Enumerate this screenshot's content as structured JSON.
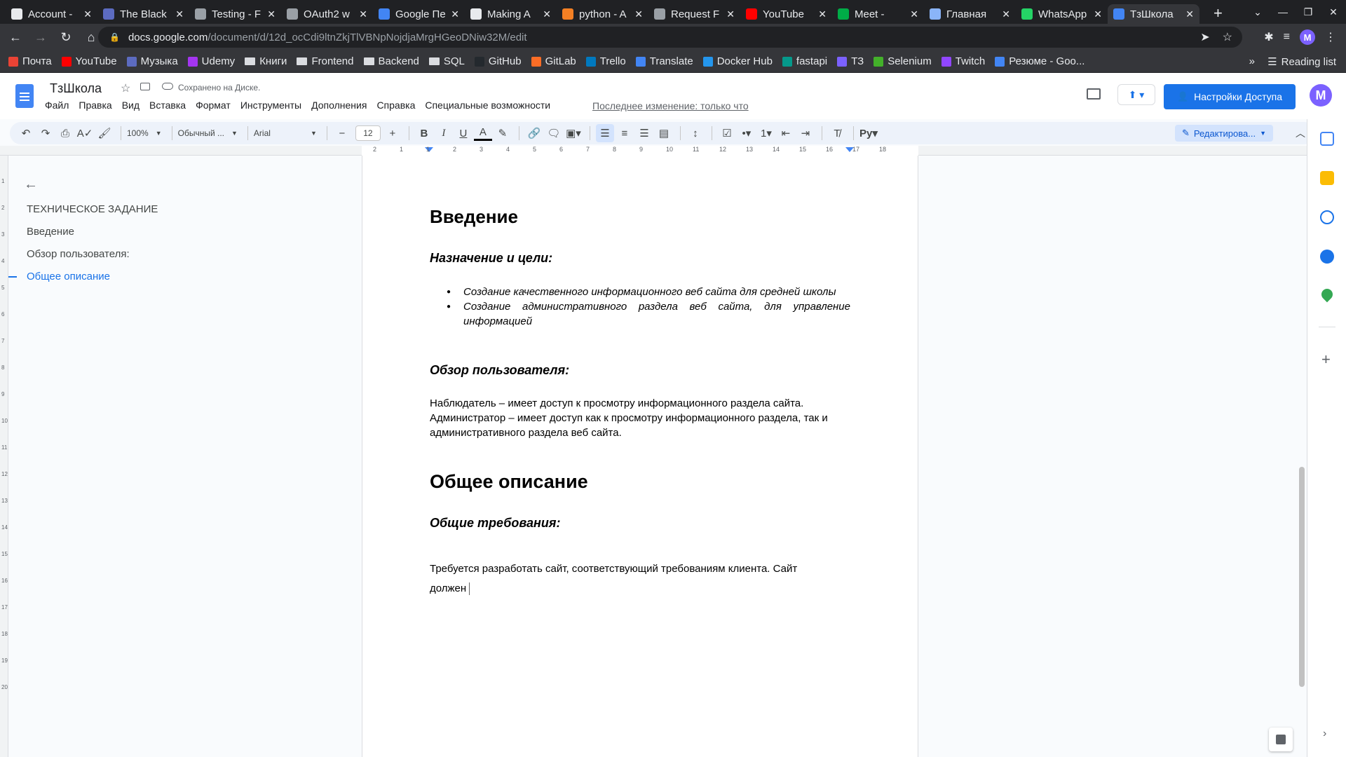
{
  "browser": {
    "tabs": [
      {
        "title": "Account -",
        "color": "#e8eaed"
      },
      {
        "title": "The Black",
        "color": "#5c6bc0"
      },
      {
        "title": "Testing - F",
        "color": "#9aa0a6"
      },
      {
        "title": "OAuth2 w",
        "color": "#9aa0a6"
      },
      {
        "title": "Google Пе",
        "color": "#4285f4"
      },
      {
        "title": "Making A",
        "color": "#e8eaed"
      },
      {
        "title": "python - A",
        "color": "#f48024"
      },
      {
        "title": "Request F",
        "color": "#9aa0a6"
      },
      {
        "title": "YouTube",
        "color": "#ff0000"
      },
      {
        "title": "Meet -",
        "color": "#00ac47"
      },
      {
        "title": "Главная",
        "color": "#8ab4f8"
      },
      {
        "title": "WhatsApp",
        "color": "#25d366"
      },
      {
        "title": "ТзШкола",
        "color": "#4285f4",
        "active": true
      }
    ],
    "url_host": "docs.google.com",
    "url_path": "/document/d/12d_ocCdi9ltnZkjTlVBNpNojdjaMrgHGeoDNiw32M/edit",
    "profile_letter": "M",
    "bookmarks": [
      {
        "label": "Почта",
        "type": "icon",
        "color": "#ea4335"
      },
      {
        "label": "YouTube",
        "type": "icon",
        "color": "#ff0000"
      },
      {
        "label": "Музыка",
        "type": "icon",
        "color": "#5c6bc0"
      },
      {
        "label": "Udemy",
        "type": "icon",
        "color": "#a435f0"
      },
      {
        "label": "Книги",
        "type": "folder"
      },
      {
        "label": "Frontend",
        "type": "folder"
      },
      {
        "label": "Backend",
        "type": "folder"
      },
      {
        "label": "SQL",
        "type": "folder"
      },
      {
        "label": "GitHub",
        "type": "icon",
        "color": "#24292e"
      },
      {
        "label": "GitLab",
        "type": "icon",
        "color": "#fc6d26"
      },
      {
        "label": "Trello",
        "type": "icon",
        "color": "#0079bf"
      },
      {
        "label": "Translate",
        "type": "icon",
        "color": "#4285f4"
      },
      {
        "label": "Docker Hub",
        "type": "icon",
        "color": "#2496ed"
      },
      {
        "label": "fastapi",
        "type": "icon",
        "color": "#05998b"
      },
      {
        "label": "ТЗ",
        "type": "icon",
        "color": "#7b61ff"
      },
      {
        "label": "Selenium",
        "type": "icon",
        "color": "#43b02a"
      },
      {
        "label": "Twitch",
        "type": "icon",
        "color": "#9146ff"
      },
      {
        "label": "Резюме - Goo...",
        "type": "icon",
        "color": "#4285f4"
      }
    ],
    "bookmarks_more": "»",
    "reading_list": "Reading list"
  },
  "docs": {
    "title": "ТзШкола",
    "saved_status": "Сохранено на Диске.",
    "menu": [
      "Файл",
      "Правка",
      "Вид",
      "Вставка",
      "Формат",
      "Инструменты",
      "Дополнения",
      "Справка",
      "Специальные возможности"
    ],
    "last_edit": "Последнее изменение: только что",
    "share_label": "Настройки Доступа",
    "avatar_letter": "M",
    "toolbar": {
      "zoom": "100%",
      "style": "Обычный ...",
      "font": "Arial",
      "font_size": "12",
      "edit_mode": "Редактирова..."
    },
    "ruler_numbers": [
      "2",
      "1",
      "1",
      "2",
      "3",
      "4",
      "5",
      "6",
      "7",
      "8",
      "9",
      "10",
      "11",
      "12",
      "13",
      "14",
      "15",
      "16",
      "17",
      "18"
    ],
    "vruler_numbers": [
      "1",
      "2",
      "3",
      "4",
      "5",
      "6",
      "7",
      "8",
      "9",
      "10",
      "11",
      "12",
      "13",
      "14",
      "15",
      "16",
      "17",
      "18",
      "19",
      "20"
    ]
  },
  "outline": {
    "items": [
      {
        "label": "ТЕХНИЧЕСКОЕ ЗАДАНИЕ",
        "active": false
      },
      {
        "label": "Введение",
        "active": false
      },
      {
        "label": "Обзор пользователя:",
        "active": false
      },
      {
        "label": "Общее описание",
        "active": true
      }
    ]
  },
  "document": {
    "heading_intro": "Введение",
    "sub_purpose": "Назначение и цели:",
    "bullets": [
      "Создание качественного информационного веб сайта для средней школы",
      "Создание административного раздела веб сайта, для управление информацией"
    ],
    "sub_users": "Обзор пользователя:",
    "users_para": "Наблюдатель – имеет доступ к просмотру информационного раздела сайта. Администратор – имеет доступ как к просмотру информационного раздела, так и административного раздела веб сайта.",
    "heading_general": "Общее описание",
    "sub_requirements": "Общие  требования:",
    "requirements_line1": "Требуется разработать сайт, соответствующий требованиям клиента. Сайт",
    "requirements_line2": "должен"
  }
}
